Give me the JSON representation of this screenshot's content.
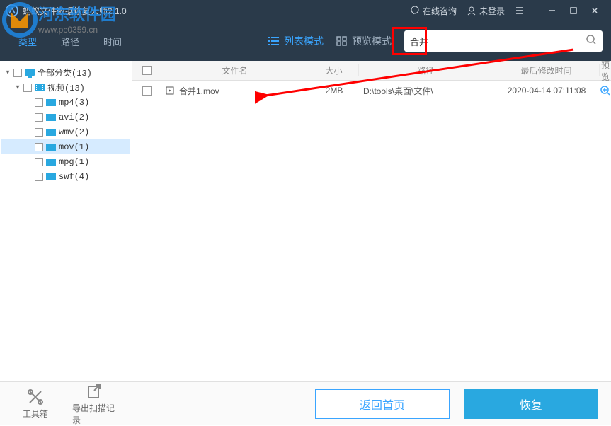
{
  "titlebar": {
    "title": "蚂蚁文件数据恢复大师2.1.0",
    "online_help": "在线咨询",
    "login": "未登录"
  },
  "tabs": {
    "type": "类型",
    "path": "路径",
    "time": "时间"
  },
  "view": {
    "list": "列表模式",
    "preview": "预览模式"
  },
  "search": {
    "value": "合并"
  },
  "tree": {
    "all": "全部分类(13)",
    "video": "视频(13)",
    "mp4": "mp4(3)",
    "avi": "avi(2)",
    "wmv": "wmv(2)",
    "mov": "mov(1)",
    "mpg": "mpg(1)",
    "swf": "swf(4)"
  },
  "columns": {
    "name": "文件名",
    "size": "大小",
    "path": "路径",
    "time": "最后修改时间",
    "preview": "预览"
  },
  "rows": [
    {
      "name": "合并1.mov",
      "size": "2MB",
      "path": "D:\\tools\\桌面\\文件\\",
      "time": "2020-04-14 07:11:08"
    }
  ],
  "bottom": {
    "toolbox": "工具箱",
    "export": "导出扫描记录",
    "home": "返回首页",
    "recover": "恢复"
  },
  "watermark": {
    "line1": "河东软件园",
    "line2": "www.pc0359.cn"
  }
}
